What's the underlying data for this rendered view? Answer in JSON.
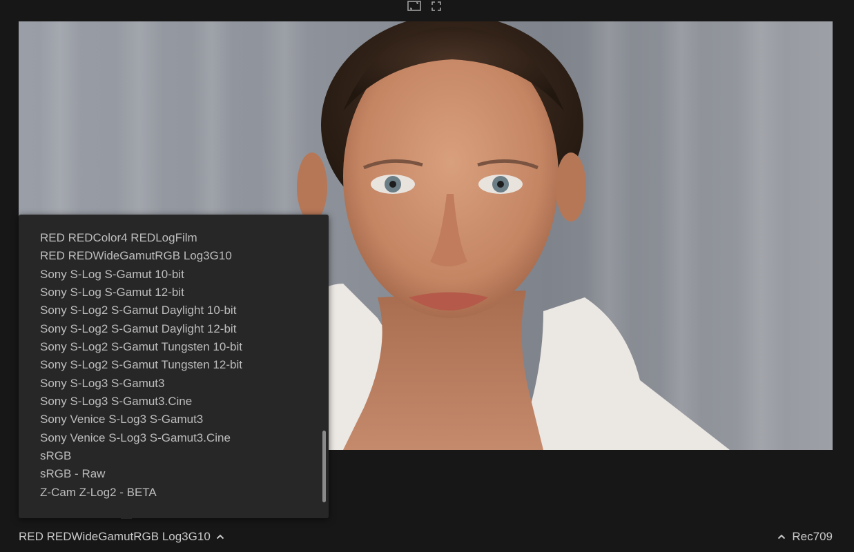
{
  "toolbar": {
    "icons": [
      "fit-to-frame-icon",
      "fullscreen-icon"
    ]
  },
  "viewer": {
    "image": "portrait-photo"
  },
  "input_profile_menu": {
    "items": [
      "RED REDColor4 REDLogFilm",
      "RED REDWideGamutRGB Log3G10",
      "Sony S-Log S-Gamut 10-bit",
      "Sony S-Log S-Gamut 12-bit",
      "Sony S-Log2 S-Gamut Daylight 10-bit",
      "Sony S-Log2 S-Gamut Daylight 12-bit",
      "Sony S-Log2 S-Gamut Tungsten 10-bit",
      "Sony S-Log2 S-Gamut Tungsten 12-bit",
      "Sony S-Log3 S-Gamut3",
      "Sony S-Log3 S-Gamut3.Cine",
      "Sony Venice S-Log3 S-Gamut3",
      "Sony Venice S-Log3 S-Gamut3.Cine",
      "sRGB",
      "sRGB - Raw",
      "Z-Cam Z-Log2 - BETA"
    ]
  },
  "bottom_bar": {
    "input_profile": "RED REDWideGamutRGB Log3G10",
    "output_profile": "Rec709",
    "input_chevron_icon": "chevron-up-icon",
    "output_chevron_icon": "chevron-up-icon"
  },
  "colors": {
    "background": "#171717",
    "popup": "#272727",
    "text": "#c9c9c9",
    "scrollbar": "#8a8a8a"
  }
}
